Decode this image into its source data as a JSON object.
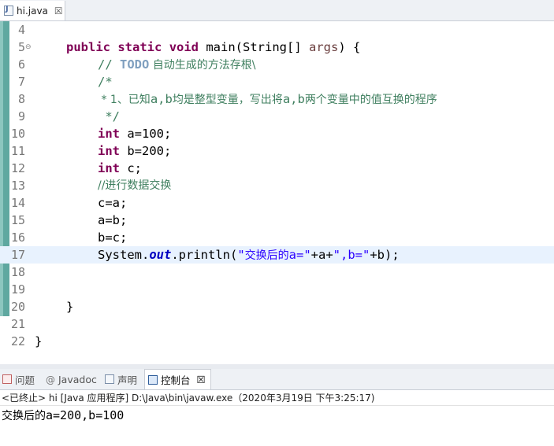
{
  "editor_tab": {
    "filename": "hi.java",
    "close": "☒"
  },
  "lines": {
    "n4": "4",
    "n5": "5",
    "n6": "6",
    "n7": "7",
    "n8": "8",
    "n9": "9",
    "n10": "10",
    "n11": "11",
    "n12": "12",
    "n13": "13",
    "n14": "14",
    "n15": "15",
    "n16": "16",
    "n17": "17",
    "n18": "18",
    "n19": "19",
    "n20": "20",
    "n21": "21",
    "n22": "22"
  },
  "code": {
    "l5_public": "public",
    "l5_static": "static",
    "l5_void": "void",
    "l5_main": " main(String[] ",
    "l5_args": "args",
    "l5_end": ") {",
    "l6_slashes": "// ",
    "l6_todo": "TODO",
    "l6_text": " 自动生成的方法存根\\",
    "l7": "/*",
    "l8_star": " * 1、已知",
    "l8_a": "a,b",
    "l8_mid": "均是整型变量，写出将",
    "l8_ab": "a,b",
    "l8_end": "两个变量中的值互换的程序",
    "l9": " */",
    "l10_kw": "int",
    "l10_rest": " a=100;",
    "l11_kw": "int",
    "l11_rest": " b=200;",
    "l12_kw": "int",
    "l12_rest": " c;",
    "l13": "//进行数据交换",
    "l14": "c=a;",
    "l15": "a=b;",
    "l16": "b=c;",
    "l17_sys": "System.",
    "l17_out": "out",
    "l17_println": ".println(",
    "l17_s1a": "\"",
    "l17_s1cn": "交换后的",
    "l17_s1b": "a=\"",
    "l17_plusa": "+a+",
    "l17_s2": "\",b=\"",
    "l17_end": "+b);",
    "l20": "}",
    "l22": "}"
  },
  "view_tabs": {
    "problems": "问题",
    "javadoc": "Javadoc",
    "declaration": "声明",
    "console": "控制台",
    "console_close": "☒"
  },
  "console": {
    "status": "<已终止> hi [Java 应用程序] D:\\Java\\bin\\javaw.exe（2020年3月19日 下午3:25:17)",
    "output_cn": "交换后的",
    "output_rest": "a=200,b=100"
  }
}
